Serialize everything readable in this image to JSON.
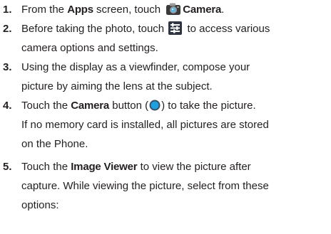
{
  "steps": [
    {
      "number": "1.",
      "lines": [
        [
          {
            "t": "From the "
          },
          {
            "b": "Apps"
          },
          {
            "t": " screen, touch "
          },
          {
            "icon": "camera-icon"
          },
          {
            "b": "Camera"
          },
          {
            "t": "."
          }
        ]
      ]
    },
    {
      "number": "2.",
      "lines": [
        [
          {
            "t": "Before taking the photo, touch "
          },
          {
            "icon": "settings-icon"
          },
          {
            "t": " to access various"
          }
        ],
        [
          {
            "t": "camera options and settings."
          }
        ]
      ]
    },
    {
      "number": "3.",
      "lines": [
        [
          {
            "t": "Using the display as a viewfinder, compose your"
          }
        ],
        [
          {
            "t": "picture by aiming the lens at the subject."
          }
        ]
      ]
    },
    {
      "number": "4.",
      "lines": [
        [
          {
            "t": "Touch the "
          },
          {
            "b": "Camera"
          },
          {
            "t": " button ("
          },
          {
            "icon": "shutter-icon"
          },
          {
            "t": ") to take the picture."
          }
        ],
        [
          {
            "t": "If no memory card is installed, all pictures are stored"
          }
        ],
        [
          {
            "t": "on the Phone."
          }
        ]
      ]
    },
    {
      "number": "5.",
      "lines": [
        [
          {
            "t": "Touch the "
          },
          {
            "b": "Image Viewer"
          },
          {
            "t": " to view the picture after"
          }
        ],
        [
          {
            "t": "capture.  While viewing the picture, select from these"
          }
        ],
        [
          {
            "t": "options:"
          }
        ]
      ]
    }
  ],
  "icons": {
    "camera-icon": {
      "body": "#3a3a3a",
      "lens": "#5fb7e6",
      "accent": "#9a9a9a"
    },
    "settings-icon": {
      "bg": "#2e3440",
      "bars": "#ffffff"
    },
    "shutter-icon": {
      "ring": "#3a5066",
      "fill": "#1e9fe0"
    }
  }
}
